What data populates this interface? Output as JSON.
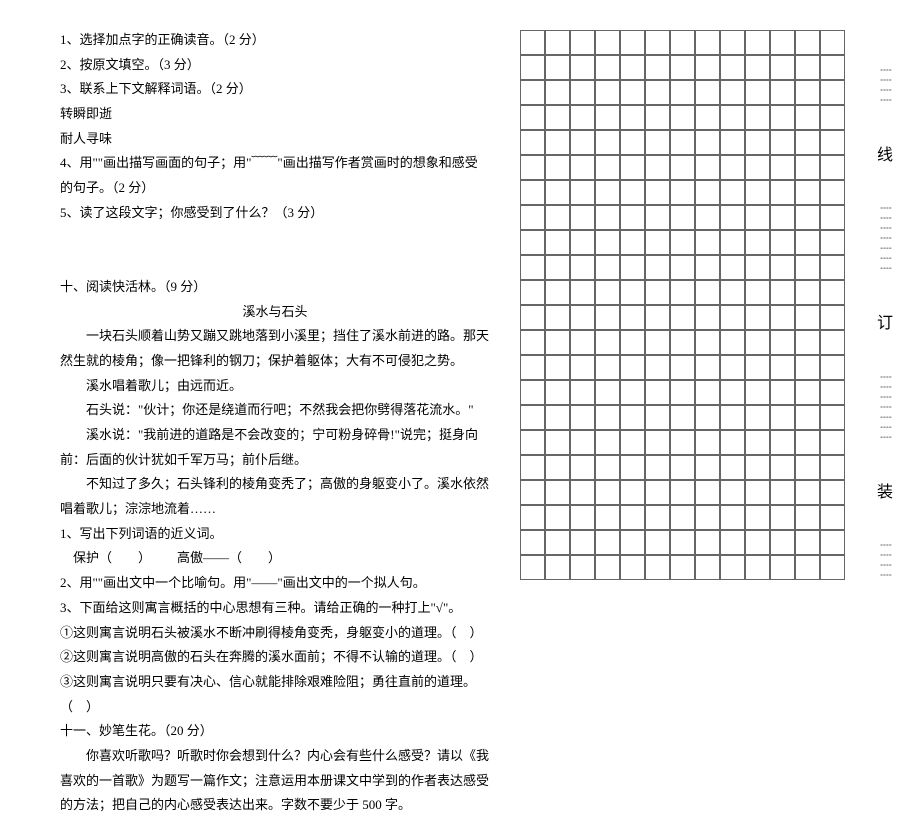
{
  "q1": "1、选择加点字的正确读音。（2 分）",
  "q2": "2、按原文填空。（3 分）",
  "q3": "3、联系上下文解释词语。（2 分）",
  "q3_term1": "转瞬即逝",
  "q3_term2": "耐人寻味",
  "q4": "4、用\"\"画出描写画面的句子；用\"﹋﹋\"画出描写作者赏画时的想象和感受的句子。（2 分）",
  "q5": "5、读了这段文字；你感受到了什么？（3 分）",
  "sec10": "十、阅读快活林。（9 分）",
  "title": "溪水与石头",
  "p1": "一块石头顺着山势又蹦又跳地落到小溪里；挡住了溪水前进的路。那天然生就的棱角；像一把锋利的钢刀；保护着躯体；大有不可侵犯之势。",
  "p2": "溪水唱着歌儿；由远而近。",
  "p3": "石头说：\"伙计；你还是绕道而行吧；不然我会把你劈得落花流水。\"",
  "p4": "溪水说：\"我前进的道路是不会改变的；宁可粉身碎骨!\"说完；挺身向前：后面的伙计犹如千军万马；前仆后继。",
  "p5": "不知过了多久；石头锋利的棱角变秃了；高傲的身躯变小了。溪水依然唱着歌儿；淙淙地流着……",
  "r1": "1、写出下列词语的近义词。",
  "r1_a": "保护（",
  "r1_b": "）",
  "r1_c": "高傲——（",
  "r1_d": "）",
  "r2": "2、用\"\"画出文中一个比喻句。用\"——\"画出文中的一个拟人句。",
  "r3": "3、下面给这则寓言概括的中心思想有三种。请给正确的一种打上\"√\"。",
  "r3_1": "①这则寓言说明石头被溪水不断冲刷得棱角变秃，身躯变小的道理。（",
  "r3_1b": "）",
  "r3_2": "②这则寓言说明高傲的石头在奔腾的溪水面前；不得不认输的道理。（",
  "r3_2b": "）",
  "r3_3": "③这则寓言说明只要有决心、信心就能排除艰难险阻；勇往直前的道理。（",
  "r3_3b": "）",
  "sec11": "十一、妙笔生花。（20 分）",
  "essay": "你喜欢听歌吗？听歌时你会想到什么？内心会有些什么感受？请以《我喜欢的一首歌》为题写一篇作文；注意运用本册课文中学到的作者表达感受的方法；把自己的内心感受表达出来。字数不要少于 500 字。",
  "bind": {
    "xian": "线",
    "ding": "订",
    "zhuang": "装"
  }
}
